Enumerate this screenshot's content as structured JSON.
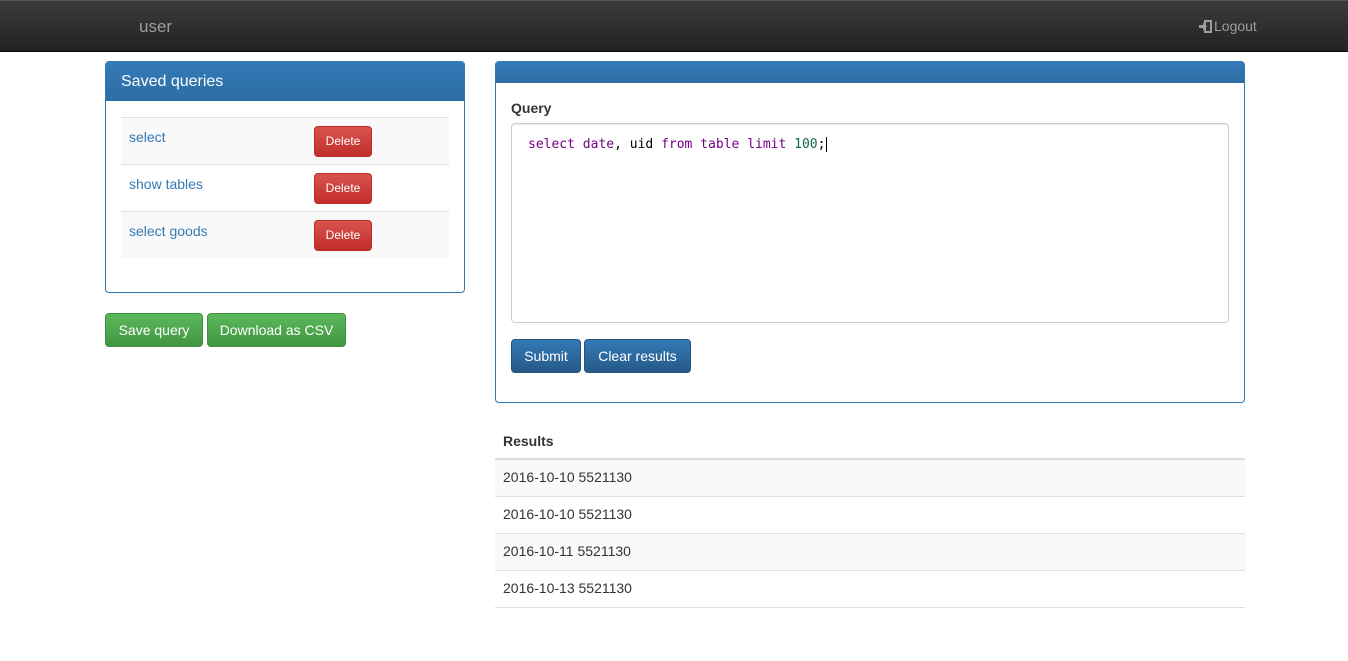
{
  "navbar": {
    "brand": "user",
    "logout_label": "Logout"
  },
  "saved_queries": {
    "title": "Saved queries",
    "items": [
      {
        "label": "select",
        "delete_label": "Delete"
      },
      {
        "label": "show tables",
        "delete_label": "Delete"
      },
      {
        "label": "select goods",
        "delete_label": "Delete"
      }
    ]
  },
  "actions": {
    "save_label": "Save query",
    "csv_label": "Download as CSV"
  },
  "query_panel": {
    "label": "Query",
    "editor_tokens": [
      {
        "text": "select",
        "kind": "keyword"
      },
      {
        "text": " date",
        "kind": "keyword"
      },
      {
        "text": ", uid ",
        "kind": "plain"
      },
      {
        "text": "from",
        "kind": "keyword"
      },
      {
        "text": " table ",
        "kind": "keyword"
      },
      {
        "text": "limit",
        "kind": "keyword"
      },
      {
        "text": " ",
        "kind": "plain"
      },
      {
        "text": "100",
        "kind": "number"
      },
      {
        "text": ";",
        "kind": "plain"
      }
    ],
    "submit_label": "Submit",
    "clear_label": "Clear results"
  },
  "results": {
    "title": "Results",
    "rows": [
      "2016-10-10 5521130",
      "2016-10-10 5521130",
      "2016-10-11 5521130",
      "2016-10-13 5521130"
    ]
  },
  "colors": {
    "primary": "#337ab7",
    "danger": "#d9534f",
    "success": "#5cb85c",
    "navbar": "#222222",
    "keyword": "#770088",
    "number": "#116644"
  },
  "icons": {
    "logout": "log-in-icon"
  }
}
